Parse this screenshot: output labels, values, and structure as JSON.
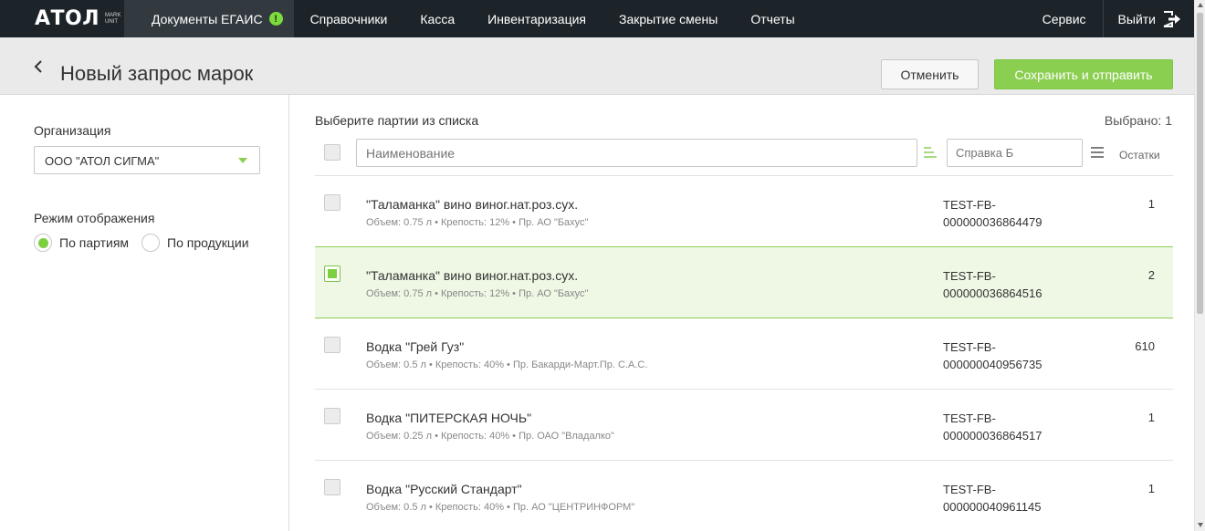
{
  "nav": {
    "logo": "АТОЛ",
    "logo_sub_1": "MARK",
    "logo_sub_2": "UNIT",
    "items": [
      {
        "label": "Документы ЕГАИС",
        "badge": "!"
      },
      {
        "label": "Справочники"
      },
      {
        "label": "Касса"
      },
      {
        "label": "Инвентаризация"
      },
      {
        "label": "Закрытие смены"
      },
      {
        "label": "Отчеты"
      }
    ],
    "service": "Сервис",
    "exit": "Выйти"
  },
  "header": {
    "title": "Новый запрос марок",
    "cancel_label": "Отменить",
    "save_label": "Сохранить и отправить"
  },
  "sidebar": {
    "org_label": "Организация",
    "org_value": "ООО \"АТОЛ СИГМА\"",
    "mode_label": "Режим отображения",
    "mode_options": [
      "По партиям",
      "По продукции"
    ],
    "mode_selected": "По партиям"
  },
  "main": {
    "title": "Выберите партии из списка",
    "selected_count": "Выбрано: 1",
    "name_placeholder": "Наименование",
    "ref_placeholder": "Справка Б",
    "col_rest": "Остатки",
    "rows": [
      {
        "name": "\"Таламанка\" вино виног.нат.роз.сух.",
        "details": "Объем: 0.75 л  •  Крепость: 12%  •  Пр. АО \"Бахус\"",
        "ref1": "TEST-FB-",
        "ref2": "000000036864479",
        "qty": "1",
        "selected": false
      },
      {
        "name": "\"Таламанка\" вино виног.нат.роз.сух.",
        "details": "Объем: 0.75 л  •  Крепость: 12%  •  Пр. АО \"Бахус\"",
        "ref1": "TEST-FB-",
        "ref2": "000000036864516",
        "qty": "2",
        "selected": true
      },
      {
        "name": "Водка \"Грей Гуз\"",
        "details": "Объем: 0.5 л  •  Крепость: 40%  •  Пр. Бакарди-Март.Пр. С.А.С.",
        "ref1": "TEST-FB-",
        "ref2": "000000040956735",
        "qty": "610",
        "selected": false
      },
      {
        "name": "Водка \"ПИТЕРСКАЯ НОЧЬ\"",
        "details": "Объем: 0.25 л  •  Крепость: 40%  •  Пр. ОАО \"Владалко\"",
        "ref1": "TEST-FB-",
        "ref2": "000000036864517",
        "qty": "1",
        "selected": false
      },
      {
        "name": "Водка \"Русский Стандарт\"",
        "details": "Объем: 0.5 л  •  Крепость: 40%  •  Пр. АО \"ЦЕНТРИНФОРМ\"",
        "ref1": "TEST-FB-",
        "ref2": "000000040961145",
        "qty": "1",
        "selected": false
      }
    ]
  },
  "colors": {
    "nav_bg": "#1d2429",
    "accent_green": "#8bcf51",
    "selected_row_bg": "#eef8e5"
  }
}
